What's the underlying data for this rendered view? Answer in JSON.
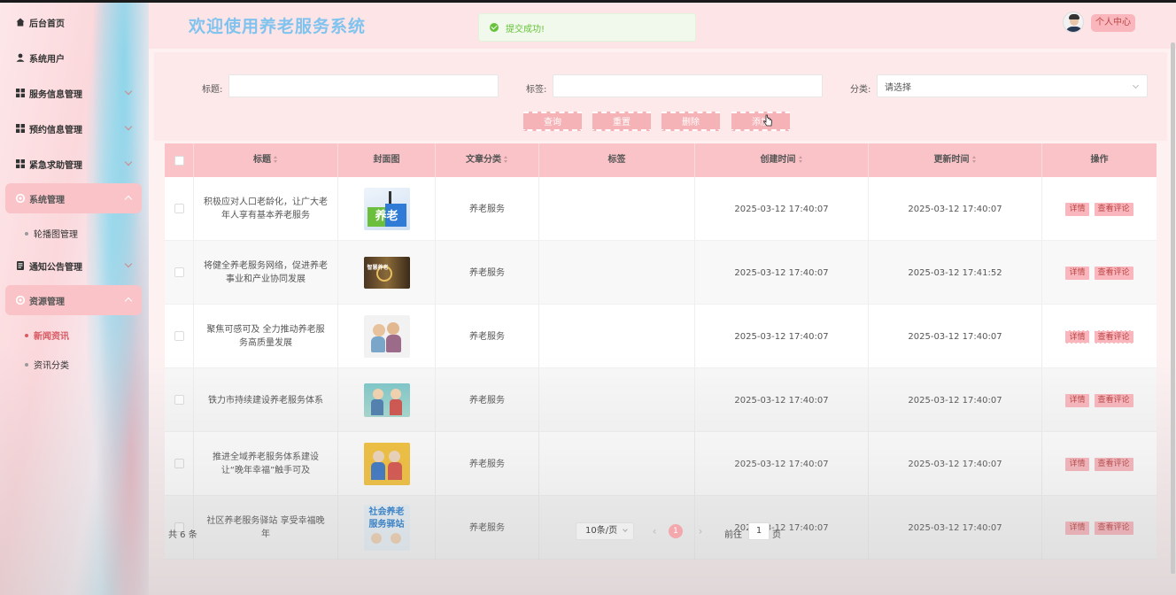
{
  "header": {
    "title": "欢迎使用养老服务系统",
    "toast": "提交成功!",
    "profile_label": "个人中心"
  },
  "sidebar": {
    "items": [
      {
        "label": "后台首页",
        "icon": "home-icon"
      },
      {
        "label": "系统用户",
        "icon": "user-icon"
      },
      {
        "label": "服务信息管理",
        "icon": "grid-icon"
      },
      {
        "label": "预约信息管理",
        "icon": "grid-icon"
      },
      {
        "label": "紧急求助管理",
        "icon": "grid-icon"
      },
      {
        "label": "系统管理",
        "icon": "settings-icon"
      },
      {
        "label": "通知公告管理",
        "icon": "document-icon"
      },
      {
        "label": "资源管理",
        "icon": "settings-icon"
      }
    ],
    "sub_system": [
      "轮播图管理"
    ],
    "sub_resource": [
      "新闻资讯",
      "资讯分类"
    ]
  },
  "search": {
    "title_label": "标题:",
    "tag_label": "标签:",
    "category_label": "分类:",
    "category_placeholder": "请选择",
    "query_btn": "查询",
    "reset_btn": "重置",
    "delete_btn": "删除",
    "add_btn": "添加"
  },
  "table": {
    "headers": [
      "标题",
      "封面图",
      "文章分类",
      "标签",
      "创建时间",
      "更新时间",
      "操作"
    ],
    "rows": [
      {
        "title": "积极应对人口老龄化，让广大老年人享有基本养老服务",
        "category": "养老服务",
        "tag": "",
        "created": "2025-03-12 17:40:07",
        "updated": "2025-03-12 17:40:07"
      },
      {
        "title": "将健全养老服务网络，促进养老事业和产业协同发展",
        "category": "养老服务",
        "tag": "",
        "created": "2025-03-12 17:40:07",
        "updated": "2025-03-12 17:41:52"
      },
      {
        "title": "聚焦可感可及 全力推动养老服务高质量发展",
        "category": "养老服务",
        "tag": "",
        "created": "2025-03-12 17:40:07",
        "updated": "2025-03-12 17:40:07"
      },
      {
        "title": "铁力市持续建设养老服务体系",
        "category": "养老服务",
        "tag": "",
        "created": "2025-03-12 17:40:07",
        "updated": "2025-03-12 17:40:07"
      },
      {
        "title": "推进全域养老服务体系建设 让“晚年幸福”触手可及",
        "category": "养老服务",
        "tag": "",
        "created": "2025-03-12 17:40:07",
        "updated": "2025-03-12 17:40:07"
      },
      {
        "title": "社区养老服务驿站 享受幸福晚年",
        "category": "养老服务",
        "tag": "",
        "created": "2025-03-12 17:40:07",
        "updated": "2025-03-12 17:40:07"
      }
    ],
    "detail_btn": "详情",
    "comments_btn": "查看评论",
    "cover_text_1": "养老",
    "cover_text_2": "智慧养老",
    "cover_text_6a": "社会养老",
    "cover_text_6b": "服务驿站"
  },
  "pagination": {
    "total": "共 6 条",
    "page_size": "10条/页",
    "current_page": "1",
    "goto_prefix": "前往",
    "goto_value": "1",
    "goto_suffix": "页"
  }
}
